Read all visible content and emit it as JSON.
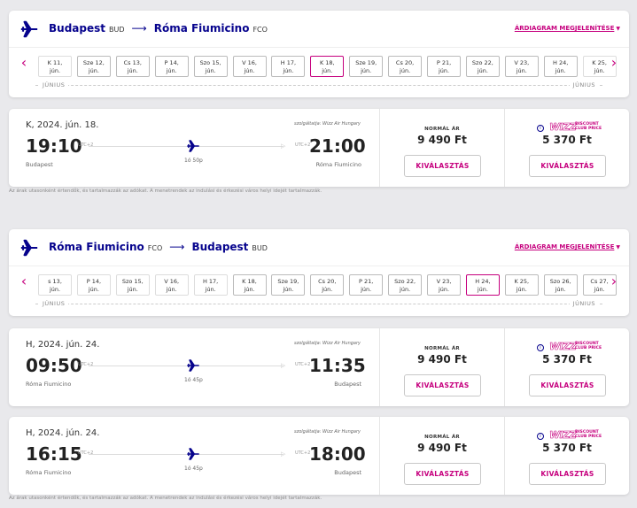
{
  "outbound": {
    "origin": "Budapest",
    "origin_code": "BUD",
    "destination": "Róma Fiumicino",
    "destination_code": "FCO",
    "chart_link": "ÁRDIAGRAM MEGJELENÍTÉSE",
    "month_left": "JÚNIUS",
    "month_right": "JÚNIUS",
    "dates": [
      {
        "day": "K 11,",
        "month": "jún.",
        "selected": false,
        "faded": true
      },
      {
        "day": "Sze 12,",
        "month": "jún.",
        "selected": false,
        "faded": false
      },
      {
        "day": "Cs 13,",
        "month": "jún.",
        "selected": false,
        "faded": false
      },
      {
        "day": "P 14,",
        "month": "jún.",
        "selected": false,
        "faded": false
      },
      {
        "day": "Szo 15,",
        "month": "jún.",
        "selected": false,
        "faded": false
      },
      {
        "day": "V 16,",
        "month": "jún.",
        "selected": false,
        "faded": false
      },
      {
        "day": "H 17,",
        "month": "jún.",
        "selected": false,
        "faded": false
      },
      {
        "day": "K 18,",
        "month": "jún.",
        "selected": true,
        "faded": false
      },
      {
        "day": "Sze 19,",
        "month": "jún.",
        "selected": false,
        "faded": false
      },
      {
        "day": "Cs 20,",
        "month": "jún.",
        "selected": false,
        "faded": false
      },
      {
        "day": "P 21,",
        "month": "jún.",
        "selected": false,
        "faded": false
      },
      {
        "day": "Szo 22,",
        "month": "jún.",
        "selected": false,
        "faded": false
      },
      {
        "day": "V 23,",
        "month": "jún.",
        "selected": false,
        "faded": false
      },
      {
        "day": "H 24,",
        "month": "jún.",
        "selected": false,
        "faded": false
      },
      {
        "day": "K 25,",
        "month": "jún.",
        "selected": false,
        "faded": true
      }
    ],
    "flights": [
      {
        "date": "K, 2024. jún. 18.",
        "operated": "szolgáltatja: Wizz Air Hungary",
        "dep_time": "19:10",
        "dep_tz": "UTC+2",
        "arr_time": "21:00",
        "arr_tz": "UTC+2",
        "dep_city": "Budapest",
        "arr_city": "Róma Fiumicino",
        "duration": "1ó 50p",
        "normal_label": "NORMÁL ÁR",
        "normal_price": "9 490 Ft",
        "club_price": "5 370 Ft",
        "select_label": "KIVÁLASZTÁS"
      }
    ]
  },
  "return": {
    "origin": "Róma Fiumicino",
    "origin_code": "FCO",
    "destination": "Budapest",
    "destination_code": "BUD",
    "chart_link": "ÁRDIAGRAM MEGJELENÍTÉSE",
    "month_left": "JÚNIUS",
    "month_right": "JÚNIUS",
    "dates": [
      {
        "day": "s 13,",
        "month": "jún.",
        "selected": false,
        "faded": true
      },
      {
        "day": "P 14,",
        "month": "jún.",
        "selected": false,
        "faded": true
      },
      {
        "day": "Szo 15,",
        "month": "jún.",
        "selected": false,
        "faded": true
      },
      {
        "day": "V 16,",
        "month": "jún.",
        "selected": false,
        "faded": true
      },
      {
        "day": "H 17,",
        "month": "jún.",
        "selected": false,
        "faded": true
      },
      {
        "day": "K 18,",
        "month": "jún.",
        "selected": false,
        "faded": false
      },
      {
        "day": "Sze 19,",
        "month": "jún.",
        "selected": false,
        "faded": false
      },
      {
        "day": "Cs 20,",
        "month": "jún.",
        "selected": false,
        "faded": false
      },
      {
        "day": "P 21,",
        "month": "jún.",
        "selected": false,
        "faded": false
      },
      {
        "day": "Szo 22,",
        "month": "jún.",
        "selected": false,
        "faded": false
      },
      {
        "day": "V 23,",
        "month": "jún.",
        "selected": false,
        "faded": false
      },
      {
        "day": "H 24,",
        "month": "jún.",
        "selected": true,
        "faded": false
      },
      {
        "day": "K 25,",
        "month": "jún.",
        "selected": false,
        "faded": false
      },
      {
        "day": "Szo 26,",
        "month": "jún.",
        "selected": false,
        "faded": false
      },
      {
        "day": "Cs 27,",
        "month": "jún.",
        "selected": false,
        "faded": false
      }
    ],
    "flights": [
      {
        "date": "H, 2024. jún. 24.",
        "operated": "szolgáltatja: Wizz Air Hungary",
        "dep_time": "09:50",
        "dep_tz": "UTC+2",
        "arr_time": "11:35",
        "arr_tz": "UTC+2",
        "dep_city": "Róma Fiumicino",
        "arr_city": "Budapest",
        "duration": "1ó 45p",
        "normal_label": "NORMÁL ÁR",
        "normal_price": "9 490 Ft",
        "club_price": "5 370 Ft",
        "select_label": "KIVÁLASZTÁS"
      },
      {
        "date": "H, 2024. jún. 24.",
        "operated": "szolgáltatja: Wizz Air Hungary",
        "dep_time": "16:15",
        "dep_tz": "UTC+2",
        "arr_time": "18:00",
        "arr_tz": "UTC+2",
        "dep_city": "Róma Fiumicino",
        "arr_city": "Budapest",
        "duration": "1ó 45p",
        "normal_label": "NORMÁL ÁR",
        "normal_price": "9 490 Ft",
        "club_price": "5 370 Ft",
        "select_label": "KIVÁLASZTÁS"
      }
    ]
  },
  "club": {
    "word": "WIZZ",
    "line1": "DISCOUNT",
    "line2": "CLUB PRICE"
  },
  "disclaimer": "Az árak utasonként értendők, és tartalmazzák az adókat. A menetrendek az indulási és érkezési város helyi idejét tartalmazzák.",
  "colors": {
    "brand_blue": "#06038d",
    "brand_magenta": "#c6007e"
  }
}
